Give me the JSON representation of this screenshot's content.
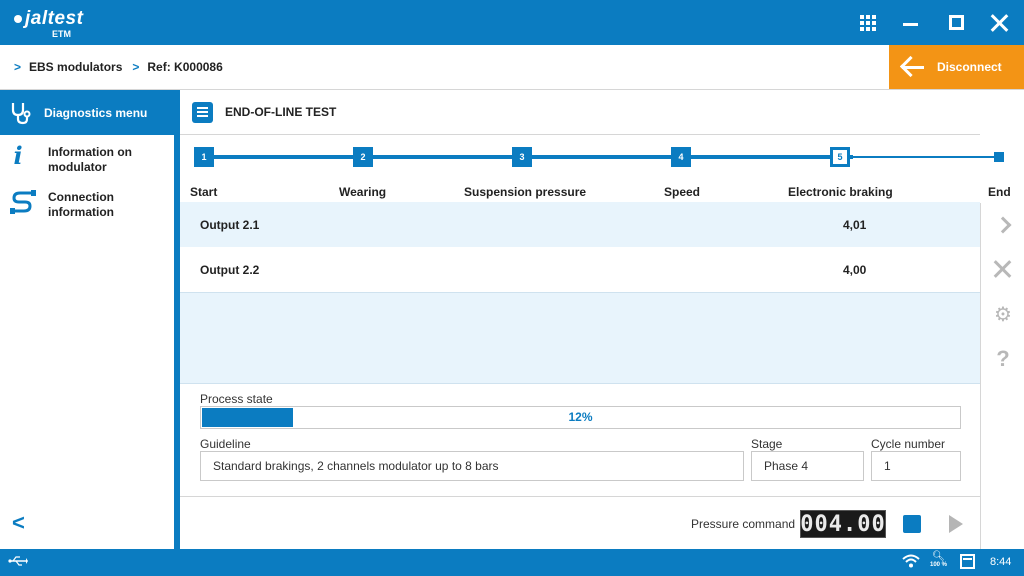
{
  "app": {
    "brand": "jaltest",
    "product": "ETM"
  },
  "window": {
    "apps_icon": "grid-icon",
    "minimize_icon": "minimize-icon",
    "maximize_icon": "maximize-icon",
    "close_icon": "close-icon"
  },
  "breadcrumb": {
    "items": [
      "EBS modulators",
      "Ref: K000086"
    ]
  },
  "disconnect": {
    "label": "Disconnect",
    "color": "#f39415"
  },
  "sidebar": {
    "items": [
      {
        "label": "Diagnostics menu",
        "icon": "stethoscope-icon",
        "active": true
      },
      {
        "label": "Information on modulator",
        "icon": "info-icon",
        "active": false
      },
      {
        "label": "Connection information",
        "icon": "connection-icon",
        "active": false
      }
    ],
    "back_icon": "chevron-left-icon"
  },
  "main": {
    "title": "END-OF-LINE TEST",
    "steps": [
      {
        "num": "1",
        "label": "Start"
      },
      {
        "num": "2",
        "label": "Wearing"
      },
      {
        "num": "3",
        "label": "Suspension pressure"
      },
      {
        "num": "4",
        "label": "Speed"
      },
      {
        "num": "5",
        "label": "Electronic braking"
      }
    ],
    "end_label": "End",
    "current_step": 5,
    "outputs": [
      {
        "name": "Output 2.1",
        "value": "4,01"
      },
      {
        "name": "Output 2.2",
        "value": "4,00"
      }
    ],
    "process_state": {
      "label": "Process state",
      "percent": 12,
      "text": "12%"
    },
    "guideline": {
      "label": "Guideline",
      "value": "Standard brakings, 2 channels modulator up to 8 bars"
    },
    "stage": {
      "label": "Stage",
      "value": "Phase 4"
    },
    "cycle": {
      "label": "Cycle number",
      "value": "1"
    },
    "pressure": {
      "label": "Pressure command",
      "display": "004.00"
    }
  },
  "rail": [
    "chevron-right-icon",
    "close-icon",
    "gear-icon",
    "help-icon"
  ],
  "status": {
    "usb_icon": "usb-icon",
    "wifi_icon": "wifi-icon",
    "zoom": "100 %",
    "calendar_icon": "calendar-icon",
    "time": "8:44"
  },
  "colors": {
    "primary": "#0b7cc1",
    "accent": "#f39415",
    "row_highlight": "#e8f4fc"
  }
}
